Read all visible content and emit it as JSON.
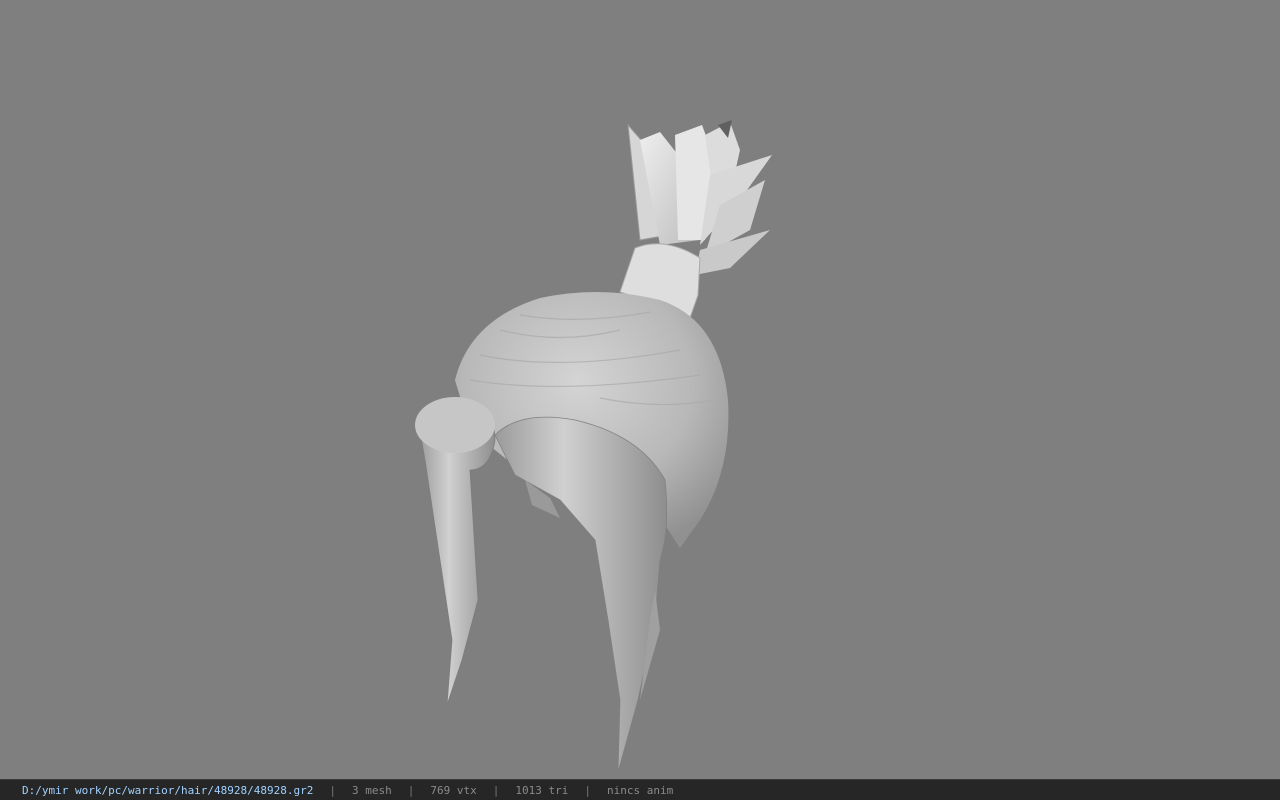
{
  "viewer": {
    "background_color": "#7f7f7f",
    "model_icon": "hair-mesh"
  },
  "status": {
    "path": "D:/ymir work/pc/warrior/hair/48928/48928.gr2",
    "separator": "|",
    "mesh": "3 mesh",
    "vtx": "769 vtx",
    "tri": "1013 tri",
    "anim": "nincs anim"
  }
}
